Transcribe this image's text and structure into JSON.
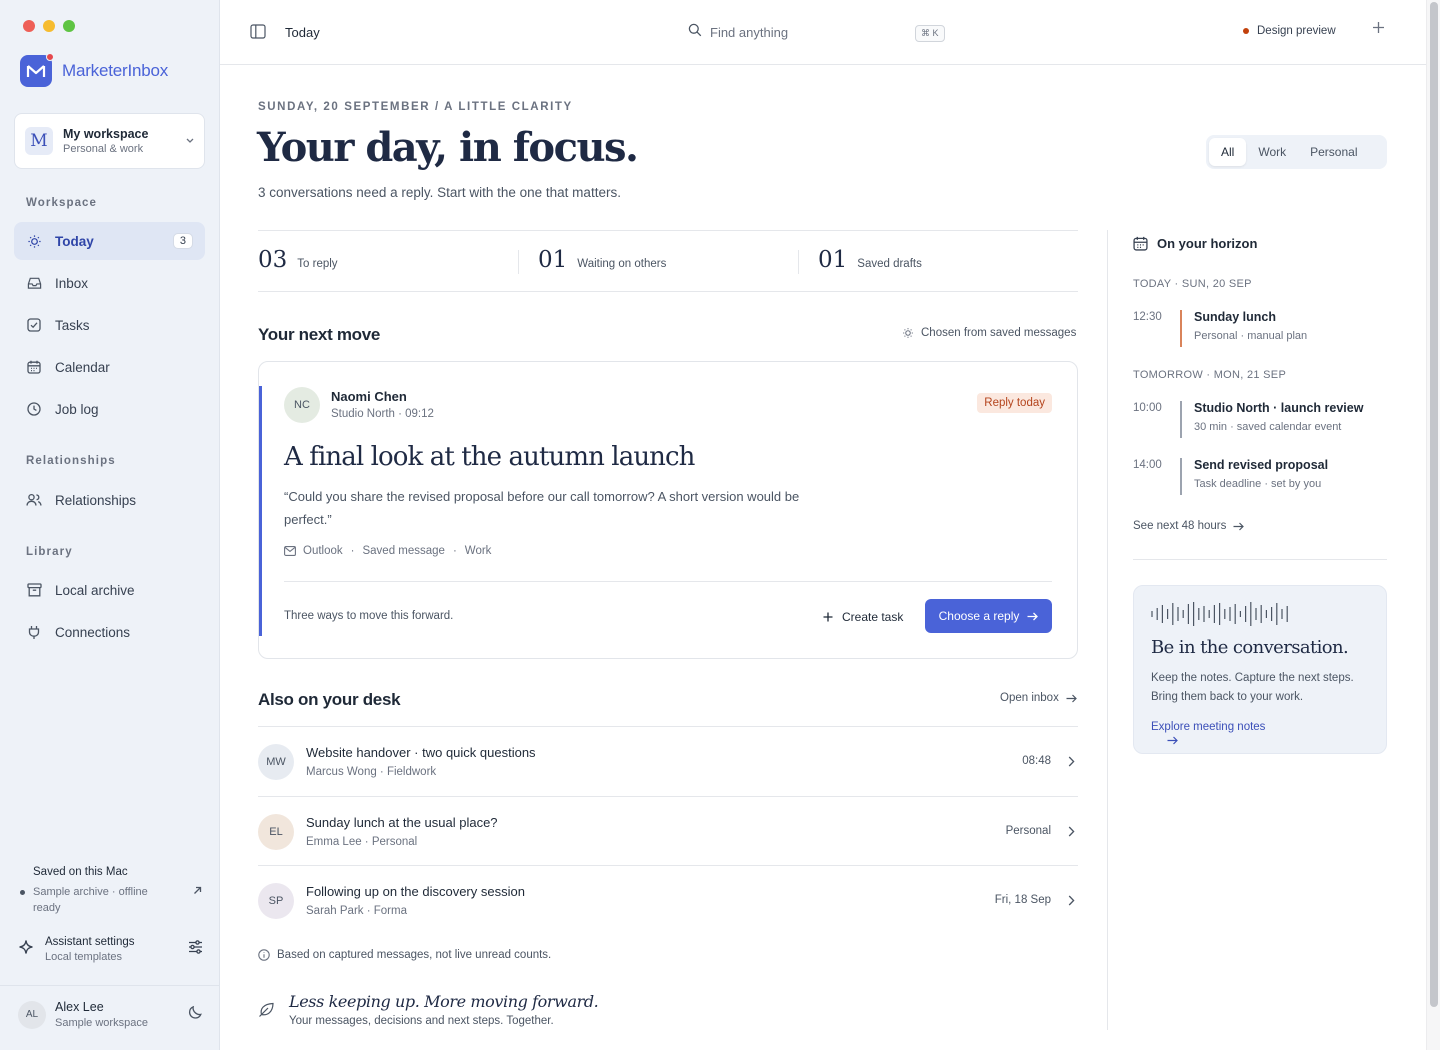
{
  "window": {
    "traffic_colors": [
      "#ee5f57",
      "#f6bc2f",
      "#5ec443"
    ]
  },
  "brand": {
    "name": "MarketerInbox",
    "color": "#4a63d8"
  },
  "workspace": {
    "initial": "M",
    "name": "My workspace",
    "subtitle": "Personal & work"
  },
  "sidebar": {
    "sections": {
      "workspace": "Workspace",
      "relationships": "Relationships",
      "library": "Library"
    },
    "items": [
      {
        "label": "Today",
        "icon": "sun-icon",
        "badge": "3",
        "active": true
      },
      {
        "label": "Inbox",
        "icon": "inbox-icon"
      },
      {
        "label": "Tasks",
        "icon": "checkbox-icon"
      },
      {
        "label": "Calendar",
        "icon": "calendar-icon"
      },
      {
        "label": "Job log",
        "icon": "clock-icon"
      },
      {
        "label": "Relationships",
        "icon": "people-icon"
      },
      {
        "label": "Local archive",
        "icon": "archive-icon"
      },
      {
        "label": "Connections",
        "icon": "plug-icon"
      }
    ],
    "saved": {
      "title": "Saved on this Mac",
      "subtitle": "Sample archive · offline ready"
    },
    "assistant": {
      "title": "Assistant settings",
      "subtitle": "Local templates"
    },
    "user": {
      "initials": "AL",
      "name": "Alex Lee",
      "subtitle": "Sample workspace"
    }
  },
  "topbar": {
    "title": "Today",
    "search_placeholder": "Find anything",
    "shortcut": "⌘ K",
    "preview": "Design preview"
  },
  "header": {
    "kicker": "SUNDAY, 20 SEPTEMBER / A LITTLE CLARITY",
    "title": "Your day, in focus.",
    "subtitle": "3 conversations need a reply. Start with the one that matters.",
    "filters": [
      "All",
      "Work",
      "Personal"
    ],
    "active_filter": "All"
  },
  "stats": [
    {
      "num": "03",
      "label": "To reply"
    },
    {
      "num": "01",
      "label": "Waiting on others"
    },
    {
      "num": "01",
      "label": "Saved drafts"
    }
  ],
  "next_move": {
    "title": "Your next move",
    "aside": "Chosen from saved messages",
    "card": {
      "initials": "NC",
      "name": "Naomi Chen",
      "org": "Studio North · 09:12",
      "tag": "Reply today",
      "subject": "A final look at the autumn launch",
      "quote": "“Could you share the revised proposal before our call tomorrow? A short version would be perfect.”",
      "meta": [
        "Outlook",
        "Saved message",
        "Work"
      ],
      "ways": "Three ways to move this forward.",
      "create_label": "Create task",
      "choose_label": "Choose a reply"
    }
  },
  "desk": {
    "title": "Also on your desk",
    "open_label": "Open inbox",
    "rows": [
      {
        "initials": "MW",
        "subject": "Website handover · two quick questions",
        "from": "Marcus Wong · Fieldwork",
        "right": "08:48",
        "avatar_bg": "#e7ebf1"
      },
      {
        "initials": "EL",
        "subject": "Sunday lunch at the usual place?",
        "from": "Emma Lee · Personal",
        "right": "Personal",
        "avatar_bg": "#f1e6dc"
      },
      {
        "initials": "SP",
        "subject": "Following up on the discovery session",
        "from": "Sarah Park · Forma",
        "right": "Fri, 18 Sep",
        "avatar_bg": "#ebe7ef"
      }
    ],
    "note": "Based on captured messages, not live unread counts."
  },
  "tagline": {
    "title": "Less keeping up. More moving forward.",
    "subtitle": "Your messages, decisions and next steps. Together."
  },
  "horizon": {
    "title": "On your horizon",
    "days": [
      {
        "label": "TODAY · SUN, 20 SEP",
        "events": [
          {
            "time": "12:30",
            "title": "Sunday lunch",
            "sub": "Personal · manual plan",
            "color": "#d9835a"
          }
        ]
      },
      {
        "label": "TOMORROW · MON, 21 SEP",
        "events": [
          {
            "time": "10:00",
            "title": "Studio North · launch review",
            "sub": "30 min · saved calendar event",
            "color": "#9ca3af"
          },
          {
            "time": "14:00",
            "title": "Send revised proposal",
            "sub": "Task deadline · set by you",
            "color": "#9ca3af"
          }
        ]
      }
    ],
    "more": "See next 48 hours"
  },
  "promo": {
    "title": "Be in the conversation.",
    "desc": "Keep the notes. Capture the next steps. Bring them back to your work.",
    "link": "Explore meeting notes"
  }
}
